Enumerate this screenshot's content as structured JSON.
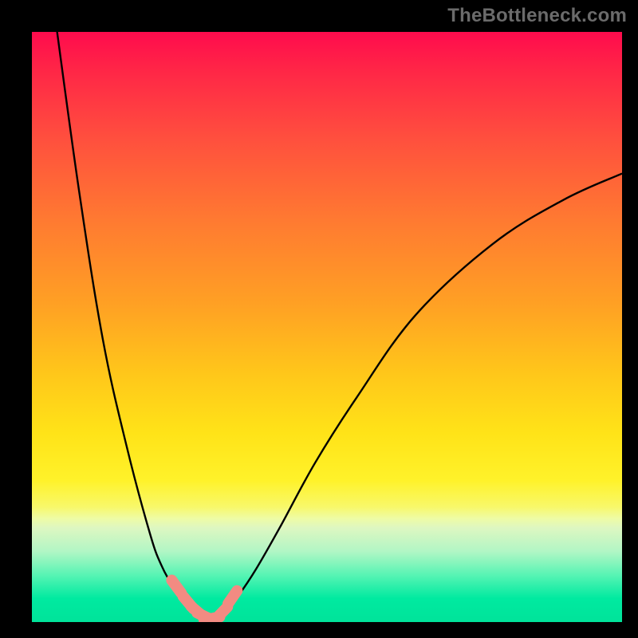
{
  "watermark": "TheBottleneck.com",
  "colors": {
    "curve": "#000000",
    "dot": "#f28b82"
  },
  "chart_data": {
    "type": "line",
    "title": "",
    "xlabel": "",
    "ylabel": "",
    "xlim": [
      0,
      100
    ],
    "ylim": [
      0,
      100
    ],
    "grid": false,
    "legend": false,
    "series": [
      {
        "name": "left-branch",
        "x": [
          4.0,
          8.0,
          12.0,
          16.0,
          20.0,
          22.0,
          24.0,
          26.0,
          28.0,
          29.0,
          30.0
        ],
        "y": [
          102.0,
          73.0,
          48.0,
          30.0,
          15.0,
          9.5,
          6.0,
          3.5,
          1.8,
          1.0,
          0.6
        ]
      },
      {
        "name": "right-branch",
        "x": [
          30.0,
          31.0,
          33.0,
          35.0,
          38.0,
          42.0,
          48.0,
          55.0,
          65.0,
          78.0,
          90.0,
          100.0
        ],
        "y": [
          0.6,
          1.0,
          2.2,
          4.5,
          9.0,
          16.0,
          27.0,
          38.0,
          52.0,
          64.0,
          71.5,
          76.0
        ]
      }
    ],
    "annotations": {
      "trough_markers": [
        {
          "x": 24.5,
          "y": 6.0
        },
        {
          "x": 26.5,
          "y": 3.3
        },
        {
          "x": 28.0,
          "y": 1.8
        },
        {
          "x": 29.2,
          "y": 1.0
        },
        {
          "x": 30.5,
          "y": 0.6
        },
        {
          "x": 32.2,
          "y": 1.6
        },
        {
          "x": 34.0,
          "y": 4.2
        }
      ]
    }
  }
}
